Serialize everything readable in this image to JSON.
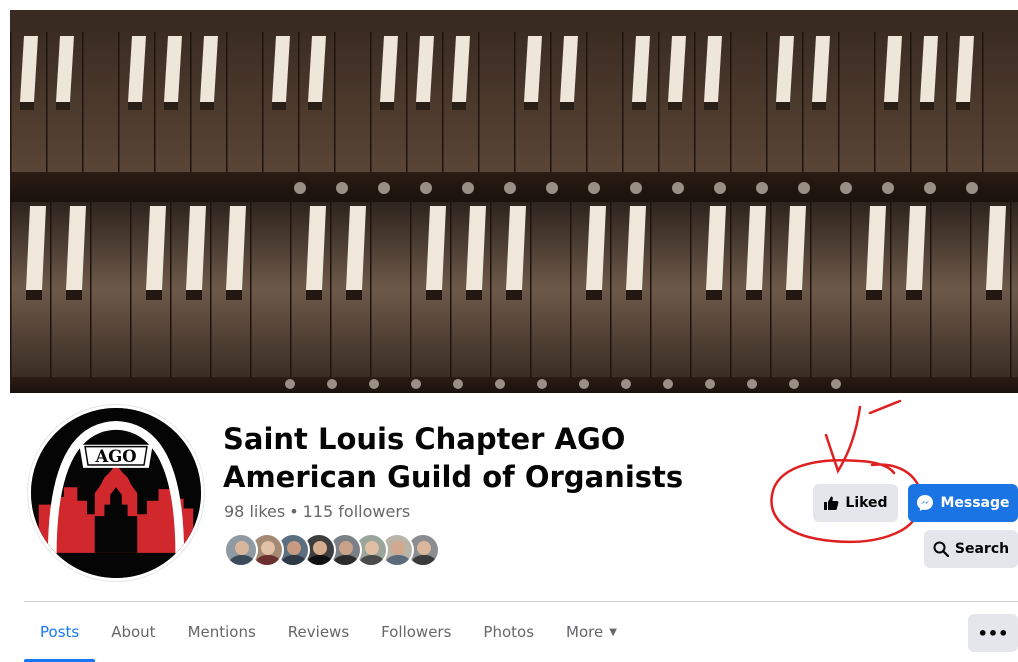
{
  "page": {
    "title": "Saint Louis Chapter AGO American Guild of Organists",
    "likes": "98 likes",
    "separator": "•",
    "followers": "115 followers"
  },
  "avatar": {
    "logo_text": "AGO",
    "icon": "ago-arch-logo"
  },
  "follower_avatars": [
    {
      "skin": "#d9b59b",
      "bg": "#8f9aa3",
      "shirt": "#3b4a5a"
    },
    {
      "skin": "#e2c1a6",
      "bg": "#a38b73",
      "shirt": "#6b2f2f"
    },
    {
      "skin": "#c89a80",
      "bg": "#5c6f80",
      "shirt": "#2d3a46"
    },
    {
      "skin": "#d6ad8f",
      "bg": "#3f3f3f",
      "shirt": "#111111"
    },
    {
      "skin": "#caa28a",
      "bg": "#7b7f86",
      "shirt": "#2b2b2b"
    },
    {
      "skin": "#e0bfa2",
      "bg": "#9aa59b",
      "shirt": "#4a4a4a"
    },
    {
      "skin": "#d2a98e",
      "bg": "#b9b3a8",
      "shirt": "#5b6b7b"
    },
    {
      "skin": "#dcb79c",
      "bg": "#8a8d91",
      "shirt": "#3a3a3a"
    }
  ],
  "actions": {
    "liked_label": "Liked",
    "liked_icon": "thumbs-up-icon",
    "message_label": "Message",
    "message_icon": "messenger-icon",
    "search_label": "Search",
    "search_icon": "search-icon",
    "more_label": "•••"
  },
  "tabs": [
    {
      "label": "Posts",
      "active": true
    },
    {
      "label": "About",
      "active": false
    },
    {
      "label": "Mentions",
      "active": false
    },
    {
      "label": "Reviews",
      "active": false
    },
    {
      "label": "Followers",
      "active": false
    },
    {
      "label": "Photos",
      "active": false
    },
    {
      "label": "More",
      "active": false,
      "dropdown": true
    }
  ],
  "colors": {
    "brand_blue": "#1877f2",
    "message_blue": "#1b74e4",
    "annotation_red": "#e02020",
    "button_gray": "#e4e6eb"
  }
}
